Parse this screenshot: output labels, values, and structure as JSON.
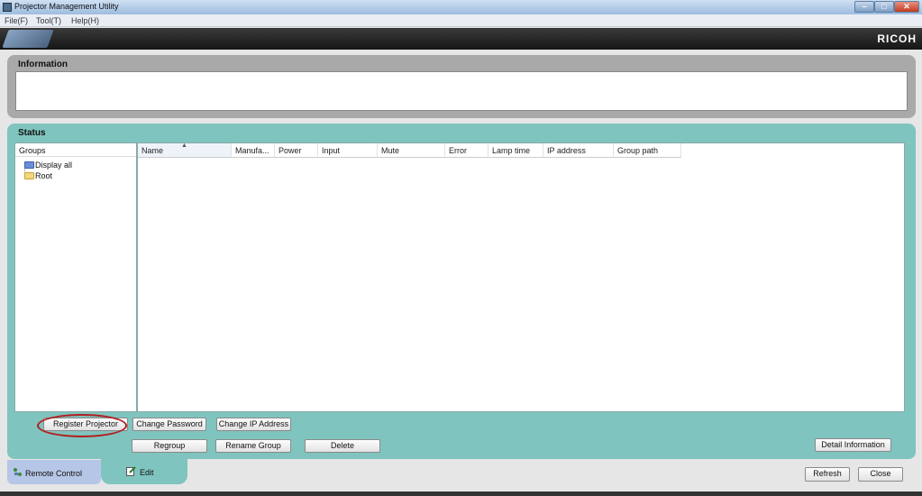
{
  "window": {
    "title": "Projector Management Utility",
    "minimize": "–",
    "maximize": "□",
    "close": "✕"
  },
  "menu": {
    "items": [
      "File(F)",
      "Tool(T)",
      "Help(H)"
    ]
  },
  "banner": {
    "brand": "RICOH"
  },
  "info": {
    "header": "Information"
  },
  "status": {
    "header": "Status",
    "groups_header": "Groups",
    "tree": [
      "Display all",
      "Root"
    ],
    "columns": [
      "Name",
      "Manufa...",
      "Power",
      "Input",
      "Mute",
      "Error",
      "Lamp time",
      "IP address",
      "Group path"
    ],
    "sort_indicator": "▲"
  },
  "buttons": {
    "register": "Register Projector",
    "change_password": "Change Password",
    "change_ip": "Change IP Address",
    "regroup": "Regroup",
    "rename_group": "Rename Group",
    "delete": "Delete",
    "detail": "Detail Information",
    "refresh": "Refresh",
    "close": "Close"
  },
  "tabs": {
    "remote": "Remote Control",
    "edit": "Edit"
  },
  "colors": {
    "panel_teal": "#7fc4bf",
    "highlight_ring": "#b21e1e",
    "banner_bg": "#1e1e1e"
  }
}
